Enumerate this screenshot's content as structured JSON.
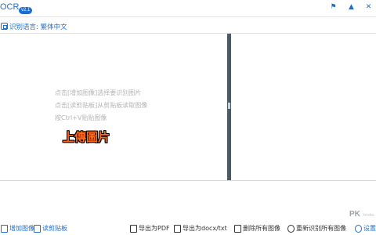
{
  "window": {
    "title": "OCR",
    "version": "v2.1",
    "icons": [
      "flag-icon",
      "pin-icon",
      "close-icon"
    ]
  },
  "language": {
    "label": "识别语言: 繁体中文"
  },
  "left_pane": {
    "hints": [
      "点击[增加图像]选择要识别图片",
      "点击[读剪贴板]从剪贴板读取图像",
      "按Ctrl+V贴贴图像"
    ],
    "upload_label": "上傳圖片"
  },
  "toolbar": {
    "add_image": "增加图像",
    "read_clipboard": "读剪贴板",
    "export_pdf": "导出为PDF",
    "export_docx": "导出为docx/txt",
    "delete_all": "删除所有图像",
    "reocr_all": "重新识别所有图像",
    "settings": "设置"
  },
  "watermark": {
    "text": "PK",
    "sub": "tricks"
  },
  "colors": {
    "accent": "#1a6fd1",
    "splitter": "#4c5a66",
    "highlight": "#ff6a1a"
  }
}
